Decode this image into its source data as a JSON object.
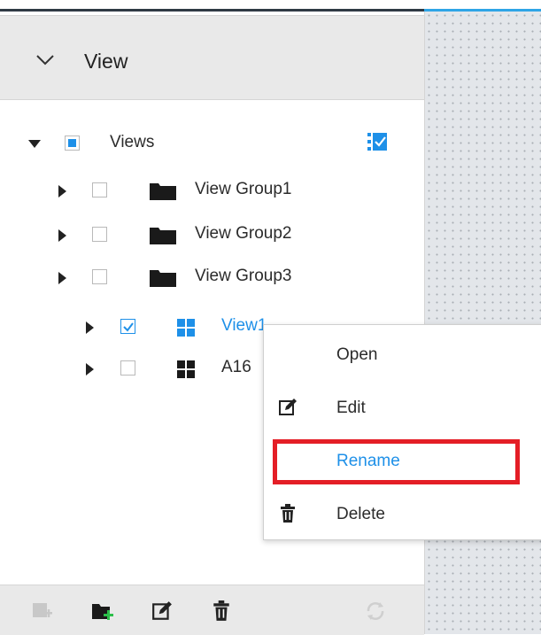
{
  "panel": {
    "header_title": "View"
  },
  "tree": {
    "root": {
      "label": "Views",
      "expanded": true,
      "check_state": "partial"
    },
    "items": [
      {
        "label": "View Group1",
        "type": "group",
        "checked": false
      },
      {
        "label": "View Group2",
        "type": "group",
        "checked": false
      },
      {
        "label": "View Group3",
        "type": "group",
        "checked": false
      },
      {
        "label": "View1",
        "type": "view",
        "checked": true,
        "selected": true
      },
      {
        "label": "A16",
        "type": "view",
        "checked": false
      }
    ]
  },
  "context_menu": {
    "items": [
      {
        "label": "Open",
        "icon": ""
      },
      {
        "label": "Edit",
        "icon": "edit-icon"
      },
      {
        "label": "Rename",
        "icon": "",
        "highlighted": true
      },
      {
        "label": "Delete",
        "icon": "trash-icon"
      }
    ]
  },
  "bottom_toolbar": {
    "icons": [
      "add-view-icon",
      "add-folder-icon",
      "edit-icon",
      "trash-icon",
      "refresh-icon"
    ]
  },
  "colors": {
    "accent": "#1e90e8",
    "highlight": "#e41e26",
    "header_bg": "#e9e9e9"
  }
}
